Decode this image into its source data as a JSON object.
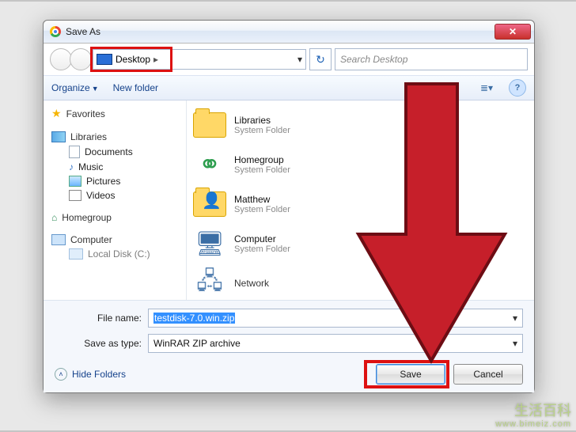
{
  "window": {
    "title": "Save As"
  },
  "nav": {
    "location": "Desktop",
    "search_placeholder": "Search Desktop"
  },
  "toolbar": {
    "organize": "Organize",
    "new_folder": "New folder"
  },
  "sidebar": {
    "favorites": "Favorites",
    "libraries": "Libraries",
    "lib_items": [
      "Documents",
      "Music",
      "Pictures",
      "Videos"
    ],
    "homegroup": "Homegroup",
    "computer": "Computer",
    "local_disk": "Local Disk (C:)"
  },
  "content": {
    "items": [
      {
        "name": "Libraries",
        "sub": "System Folder",
        "icon": "folder"
      },
      {
        "name": "Homegroup",
        "sub": "System Folder",
        "icon": "homegroup"
      },
      {
        "name": "Matthew",
        "sub": "System Folder",
        "icon": "user"
      },
      {
        "name": "Computer",
        "sub": "System Folder",
        "icon": "computer"
      },
      {
        "name": "Network",
        "sub": "",
        "icon": "network"
      }
    ]
  },
  "form": {
    "filename_label": "File name:",
    "filename_value": "testdisk-7.0.win.zip",
    "type_label": "Save as type:",
    "type_value": "WinRAR ZIP archive",
    "hide_folders": "Hide Folders",
    "save": "Save",
    "cancel": "Cancel"
  },
  "overlay": {
    "watermark_main": "生活百科",
    "watermark_url": "www.bimeiz.com"
  }
}
